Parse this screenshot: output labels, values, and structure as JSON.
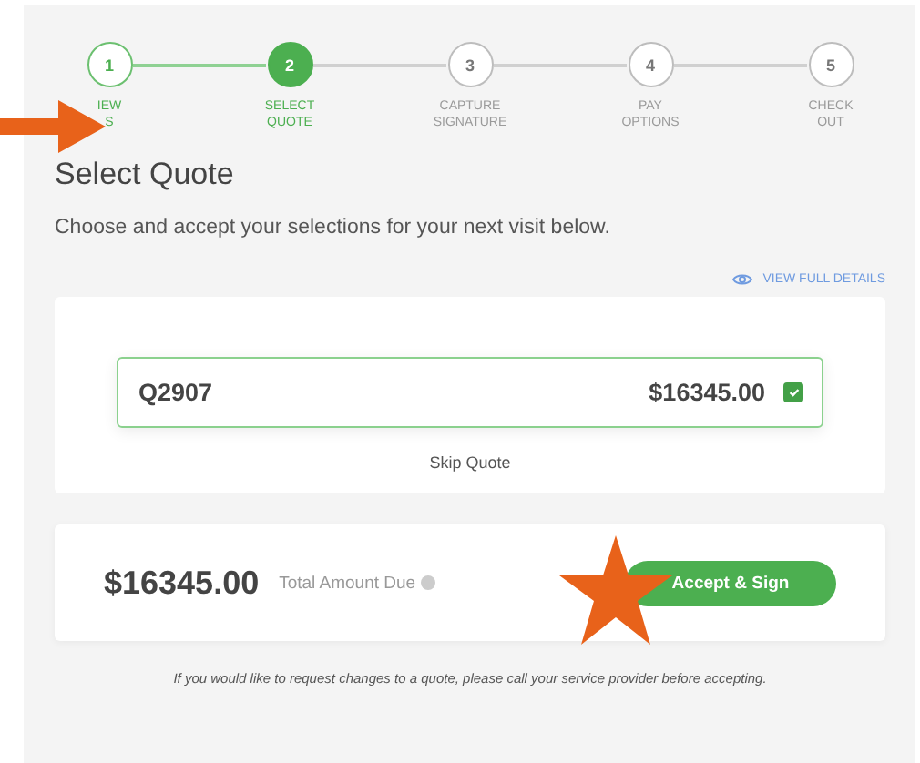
{
  "steps": [
    {
      "number": "1",
      "label": [
        "IEW",
        "S"
      ],
      "completed": true,
      "selected": false
    },
    {
      "number": "2",
      "label": [
        "SELECT",
        "QUOTE"
      ],
      "completed": false,
      "selected": true
    },
    {
      "number": "3",
      "label": [
        "CAPTURE",
        "SIGNATURE"
      ],
      "completed": false,
      "selected": false
    },
    {
      "number": "4",
      "label": [
        "PAY",
        "OPTIONS"
      ],
      "completed": false,
      "selected": false
    },
    {
      "number": "5",
      "label": [
        "CHECK",
        "OUT"
      ],
      "completed": false,
      "selected": false
    }
  ],
  "title": "Select Quote",
  "subtitle": "Choose and accept your selections for your next visit below.",
  "details_link": "VIEW FULL DETAILS",
  "quote": {
    "id": "Q2907",
    "amount": "$16345.00",
    "checked": true
  },
  "skip_link": "Skip Quote",
  "total": {
    "amount": "$16345.00",
    "label": "Total Amount Due"
  },
  "accept_button": "Accept & Sign",
  "footer_note": "If you would like to request changes to a quote, please call your service provider before accepting."
}
